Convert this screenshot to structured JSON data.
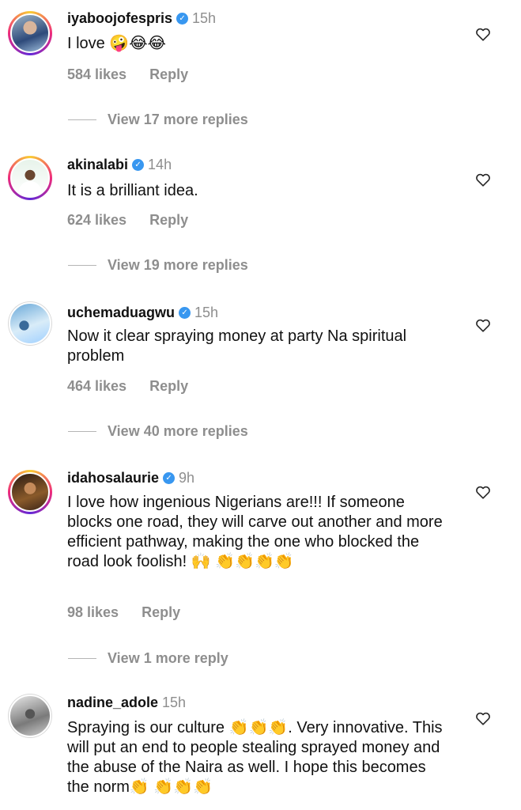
{
  "comments": [
    {
      "username": "iyaboojofespris",
      "time": "15h",
      "text": "I love 🤪😂😂",
      "likes": "584 likes",
      "reply": "Reply",
      "view_replies": "View 17 more replies"
    },
    {
      "username": "akinalabi",
      "time": "14h",
      "text": "It is a brilliant idea.",
      "likes": "624 likes",
      "reply": "Reply",
      "view_replies": "View 19 more replies"
    },
    {
      "username": "uchemaduagwu",
      "time": "15h",
      "text": "Now it clear spraying money at party Na spiritual problem",
      "likes": "464 likes",
      "reply": "Reply",
      "view_replies": "View 40 more replies"
    },
    {
      "username": "idahosalaurie",
      "time": "9h",
      "text": "I love how ingenious Nigerians are!!! If someone blocks one road, they will carve out another and more efficient pathway, making the one who blocked the road look foolish! 🙌 👏👏👏👏",
      "likes": "98 likes",
      "reply": "Reply",
      "view_replies": "View 1 more reply"
    },
    {
      "username": "nadine_adole",
      "time": "15h",
      "text": "Spraying is our culture 👏👏👏. Very innovative. This will put an end to people stealing sprayed money and the abuse of the Naira as well. I hope this becomes the norm👏 👏👏👏"
    }
  ],
  "icons": {
    "verified": "verified-badge-icon",
    "like": "heart-icon"
  },
  "colors": {
    "verified": "#3897f0",
    "secondary_text": "#8e8e8e"
  }
}
